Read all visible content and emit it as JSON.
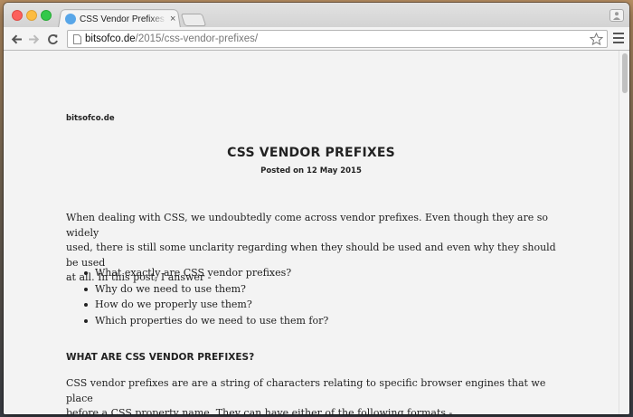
{
  "browser": {
    "tab": {
      "title": "CSS Vendor Prefixes - bitsofco.de",
      "close_glyph": "×"
    },
    "address_bar": {
      "host": "bitsofco.de",
      "path": "/2015/css-vendor-prefixes/"
    },
    "icons": [
      "back-arrow-icon",
      "forward-arrow-icon",
      "reload-icon",
      "page-icon",
      "star-icon",
      "menu-icon",
      "profile-icon"
    ]
  },
  "page": {
    "site_name": "bitsofco.de",
    "title": "CSS VENDOR PREFIXES",
    "date": "Posted on 12 May 2015",
    "intro": [
      "When dealing with CSS, we undoubtedly come across vendor prefixes. Even though they are so widely",
      "used, there is still some unclarity regarding when they should be used and even why they should be used",
      "at all. In this post, I answer -"
    ],
    "questions": [
      "What exactly are CSS vendor prefixes?",
      "Why do we need to use them?",
      "How do we properly use them?",
      "Which properties do we need to use them for?"
    ],
    "section_heading": "WHAT ARE CSS VENDOR PREFIXES?",
    "section_text": [
      "CSS vendor prefixes are are a string of characters relating to specific browser engines that we place",
      "before a CSS property name. They can have either of the following formats -"
    ]
  }
}
